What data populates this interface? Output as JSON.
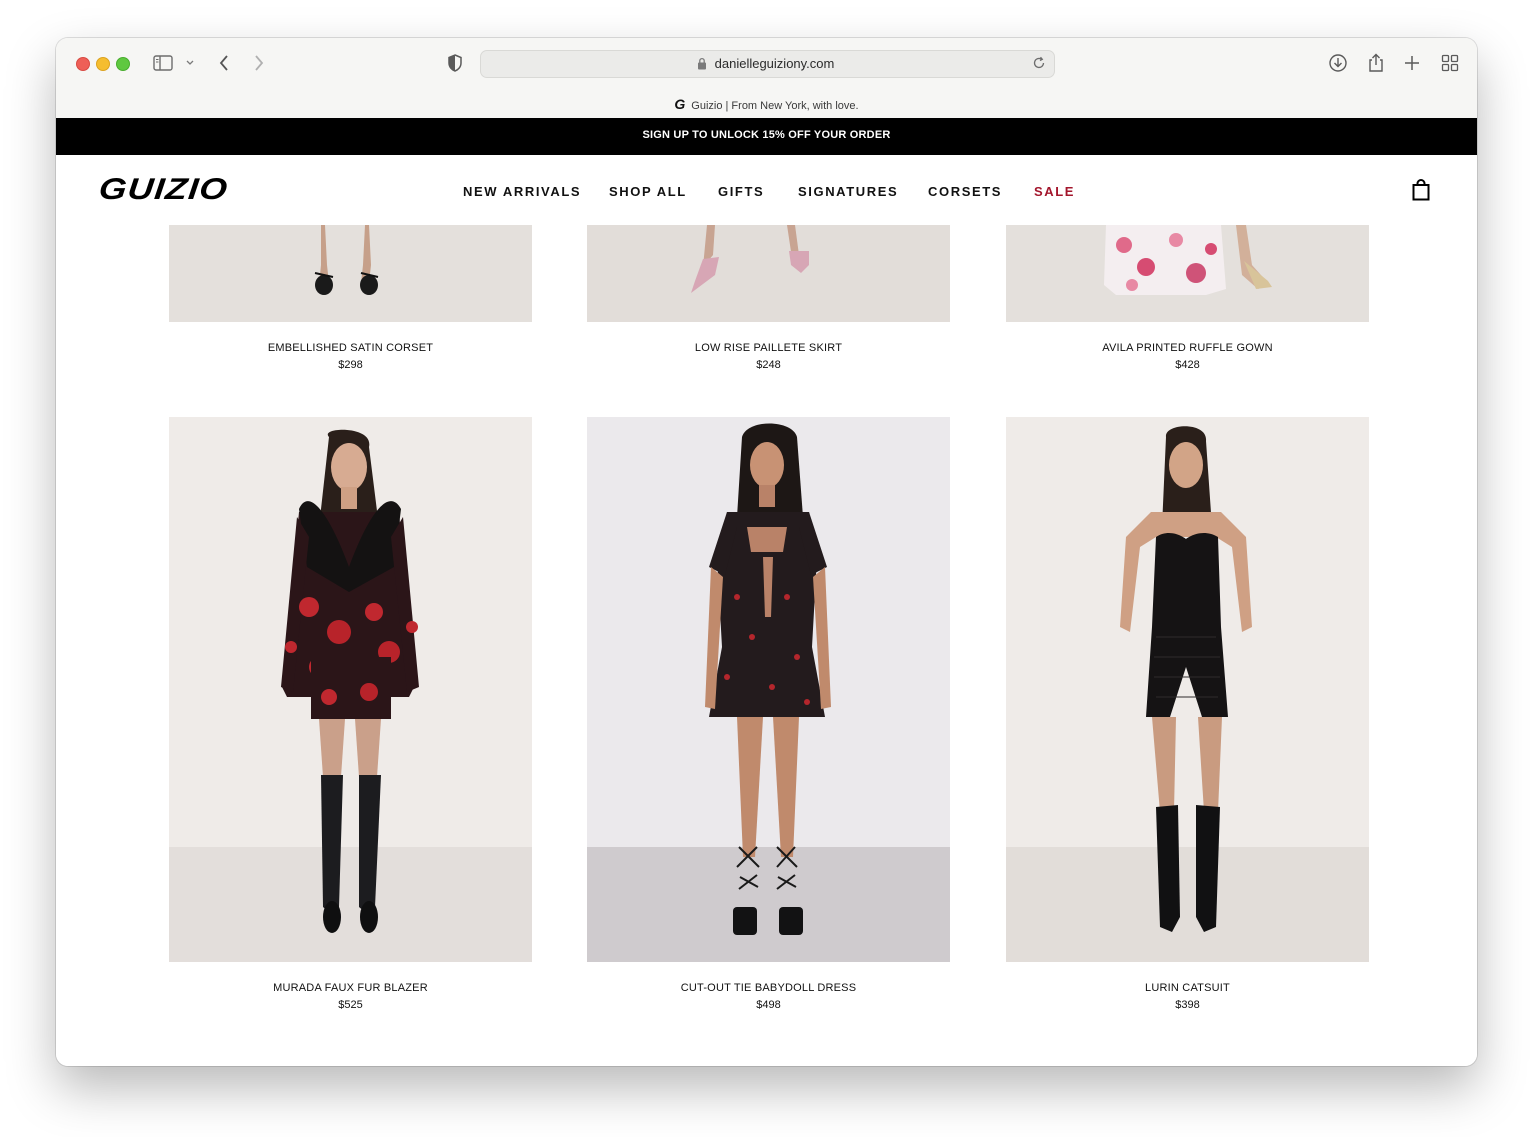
{
  "browser": {
    "url": "danielleguiziony.com",
    "tab_title": "Guizio | From New York, with love.",
    "tab_favicon": "G"
  },
  "promo": {
    "text": "SIGN UP TO UNLOCK 15% OFF YOUR ORDER"
  },
  "header": {
    "logo": "GUIZIO",
    "nav": [
      {
        "label": "NEW ARRIVALS"
      },
      {
        "label": "SHOP ALL"
      },
      {
        "label": "GIFTS"
      },
      {
        "label": "SIGNATURES"
      },
      {
        "label": "CORSETS"
      },
      {
        "label": "SALE",
        "color": "#a3162c"
      }
    ],
    "cart_icon": "shopping-bag-icon"
  },
  "products": [
    {
      "name": "EMBELLISHED SATIN CORSET",
      "price": "$298"
    },
    {
      "name": "LOW RISE PAILLETE SKIRT",
      "price": "$248"
    },
    {
      "name": "AVILA PRINTED RUFFLE GOWN",
      "price": "$428"
    },
    {
      "name": "MURADA FAUX FUR BLAZER",
      "price": "$525"
    },
    {
      "name": "CUT-OUT TIE BABYDOLL DRESS",
      "price": "$498"
    },
    {
      "name": "LURIN CATSUIT",
      "price": "$398"
    }
  ],
  "colors": {
    "promo_bg": "#000000",
    "sale": "#a3162c",
    "photo_bg": "#efebe8"
  }
}
